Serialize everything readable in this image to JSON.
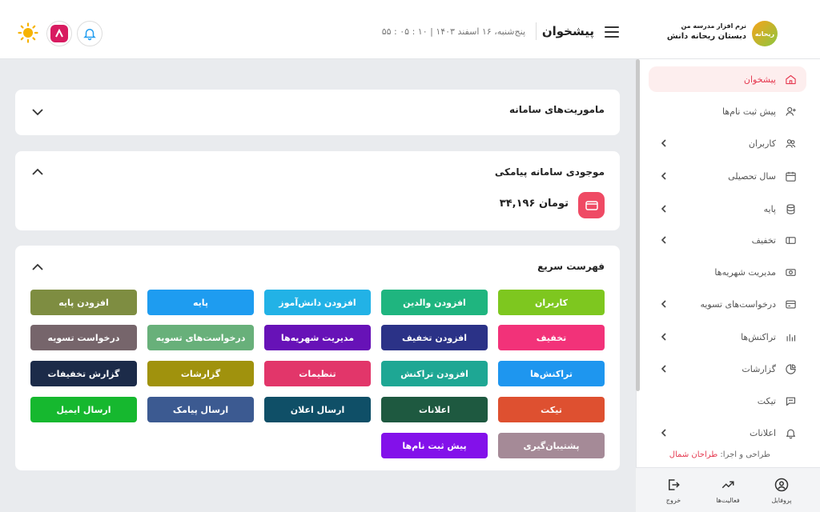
{
  "brand": {
    "line1": "نرم افزار مدرسه من",
    "line2": "دبستان ریحانه دانش",
    "logo_text": "ریحانه"
  },
  "header": {
    "title": "پیشخوان",
    "datetime": "پنج‌شنبه، ۱۶ اسفند ۱۴۰۳ | ۱۰ : ۰۵ : ۵۵",
    "icons": [
      "bell-icon",
      "app-logo-icon",
      "sun-icon"
    ]
  },
  "sidebar": {
    "items": [
      {
        "label": "پیشخوان",
        "icon": "home-icon",
        "active": true,
        "chevron": false
      },
      {
        "label": "پیش ثبت نام‌ها",
        "icon": "user-plus-icon",
        "active": false,
        "chevron": false
      },
      {
        "label": "کاربران",
        "icon": "users-icon",
        "active": false,
        "chevron": true
      },
      {
        "label": "سال تحصیلی",
        "icon": "calendar-icon",
        "active": false,
        "chevron": true
      },
      {
        "label": "پایه",
        "icon": "database-icon",
        "active": false,
        "chevron": true
      },
      {
        "label": "تخفیف",
        "icon": "ticket-icon",
        "active": false,
        "chevron": true
      },
      {
        "label": "مدیریت شهریه‌ها",
        "icon": "cash-icon",
        "active": false,
        "chevron": false
      },
      {
        "label": "درخواست‌های تسویه",
        "icon": "card-icon",
        "active": false,
        "chevron": true
      },
      {
        "label": "تراکنش‌ها",
        "icon": "bars-icon",
        "active": false,
        "chevron": true
      },
      {
        "label": "گزارشات",
        "icon": "pie-icon",
        "active": false,
        "chevron": true
      },
      {
        "label": "تیکت",
        "icon": "chat-icon",
        "active": false,
        "chevron": false
      },
      {
        "label": "اعلانات",
        "icon": "bell-icon",
        "active": false,
        "chevron": true
      }
    ],
    "credit_prefix": "طراحی و اجرا:",
    "credit_name": "طراحان شمال"
  },
  "bottom_nav": [
    {
      "label": "پروفایل",
      "icon": "profile-icon"
    },
    {
      "label": "فعالیت‌ها",
      "icon": "trend-icon"
    },
    {
      "label": "خروج",
      "icon": "logout-icon"
    }
  ],
  "cards": {
    "missions": {
      "title": "ماموریت‌های سامانه"
    },
    "sms": {
      "title": "موجودی سامانه پیامکی",
      "balance": "۳۴,۱۹۶ تومان"
    },
    "quick": {
      "title": "فهرست سریع"
    }
  },
  "quick_buttons": [
    {
      "label": "کاربران",
      "color": "#7ec71f"
    },
    {
      "label": "افزودن والدین",
      "color": "#1fb57f"
    },
    {
      "label": "افزودن دانش‌آموز",
      "color": "#22b2e6"
    },
    {
      "label": "پایه",
      "color": "#1e9cf0"
    },
    {
      "label": "افزودن پایه",
      "color": "#7e8d41"
    },
    {
      "label": "تخفیف",
      "color": "#f23279"
    },
    {
      "label": "افزودن تخفیف",
      "color": "#2b3287"
    },
    {
      "label": "مدیریت شهریه‌ها",
      "color": "#6712b7"
    },
    {
      "label": "درخواست‌های تسویه",
      "color": "#68b07a"
    },
    {
      "label": "درخواست تسویه",
      "color": "#76656b"
    },
    {
      "label": "تراکنش‌ها",
      "color": "#1e96ef"
    },
    {
      "label": "افزودن تراکنش",
      "color": "#1ea794"
    },
    {
      "label": "تنظیمات",
      "color": "#e2366a"
    },
    {
      "label": "گزارشات",
      "color": "#a0920d"
    },
    {
      "label": "گزارش تخفیفات",
      "color": "#1c2b49"
    },
    {
      "label": "تیکت",
      "color": "#de5030"
    },
    {
      "label": "اعلانات",
      "color": "#1e5940"
    },
    {
      "label": "ارسال اعلان",
      "color": "#0f4f67"
    },
    {
      "label": "ارسال پیامک",
      "color": "#3c5a91"
    },
    {
      "label": "ارسال ایمیل",
      "color": "#16b82f"
    },
    {
      "label": "پشتیبان‌گیری",
      "color": "#a58a97"
    },
    {
      "label": "پیش ثبت نام‌ها",
      "color": "#8311ea"
    }
  ],
  "colors": {
    "accent": "#e53950",
    "wallet": "#ef4a64"
  }
}
